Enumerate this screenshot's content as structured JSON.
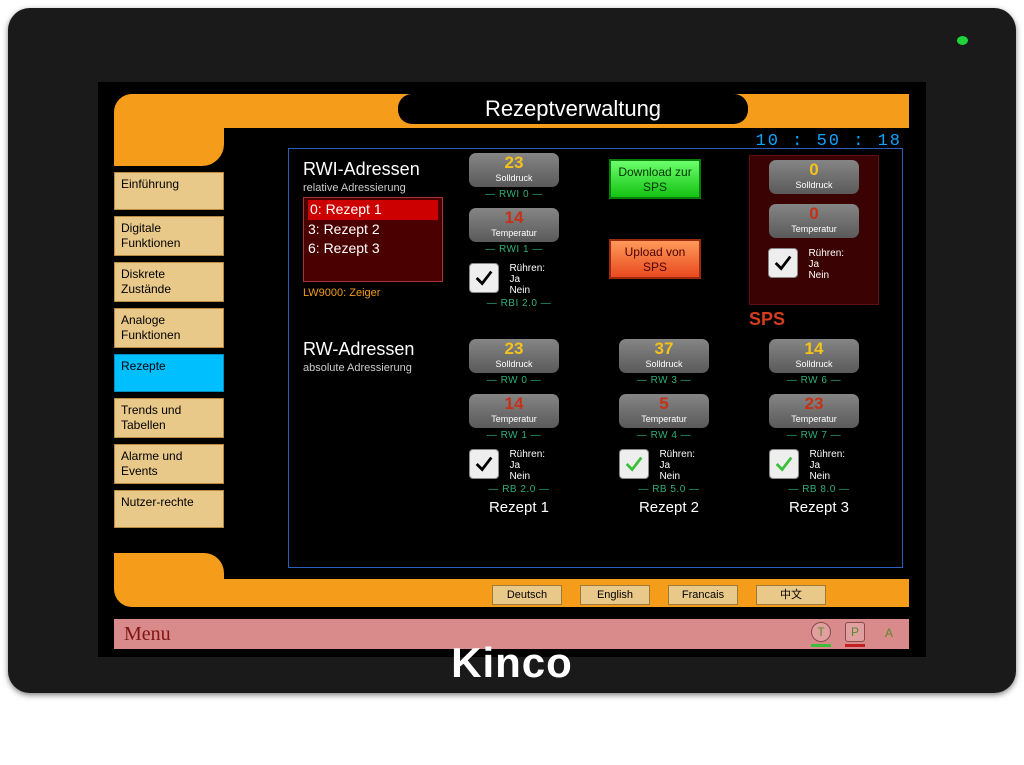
{
  "brand": "Kinco",
  "header": {
    "title": "Rezeptverwaltung",
    "clock": "10 : 50 : 18"
  },
  "sidebar": {
    "items": [
      "Einführung",
      "Digitale Funktionen",
      "Diskrete Zustände",
      "Analoge Funktionen",
      "Rezepte",
      "Trends und Tabellen",
      "Alarme und Events",
      "Nutzer-rechte"
    ],
    "active_index": 4
  },
  "rwi": {
    "title": "RWI-Adressen",
    "subtitle": "relative Adressierung",
    "recipes": [
      "0: Rezept 1",
      "3: Rezept 2",
      "6: Rezept 3"
    ],
    "pointer": "LW9000: Zeiger",
    "solldruck": {
      "value": "23",
      "label": "Solldruck",
      "addr": "— RWI 0 —"
    },
    "temperatur": {
      "value": "14",
      "label": "Temperatur",
      "addr": "— RWI 1 —"
    },
    "ruehren": {
      "label": "Rühren:",
      "ja": "Ja",
      "nein": "Nein",
      "addr": "— RBI 2.0 —",
      "checked": true,
      "check_color": "black"
    }
  },
  "buttons": {
    "download": "Download zur SPS",
    "upload": "Upload von SPS"
  },
  "sps": {
    "label": "SPS",
    "solldruck": {
      "value": "0",
      "label": "Solldruck"
    },
    "temperatur": {
      "value": "0",
      "label": "Temperatur"
    },
    "ruehren": {
      "label": "Rühren:",
      "ja": "Ja",
      "nein": "Nein",
      "checked": true,
      "check_color": "black"
    }
  },
  "rw": {
    "title": "RW-Adressen",
    "subtitle": "absolute Adressierung",
    "cols": [
      {
        "name": "Rezept 1",
        "solldruck": {
          "value": "23",
          "label": "Solldruck",
          "addr": "— RW 0 —"
        },
        "temperatur": {
          "value": "14",
          "label": "Temperatur",
          "addr": "— RW 1 —"
        },
        "ruehren": {
          "addr": "— RB 2.0 —",
          "check_color": "black"
        }
      },
      {
        "name": "Rezept 2",
        "solldruck": {
          "value": "37",
          "label": "Solldruck",
          "addr": "— RW 3 —"
        },
        "temperatur": {
          "value": "5",
          "label": "Temperatur",
          "addr": "— RW 4 —"
        },
        "ruehren": {
          "addr": "— RB 5.0 —",
          "check_color": "green"
        }
      },
      {
        "name": "Rezept 3",
        "solldruck": {
          "value": "14",
          "label": "Solldruck",
          "addr": "— RW 6 —"
        },
        "temperatur": {
          "value": "23",
          "label": "Temperatur",
          "addr": "— RW 7 —"
        },
        "ruehren": {
          "addr": "— RB 8.0 —",
          "check_color": "green"
        }
      }
    ],
    "ruehren_label": {
      "title": "Rühren:",
      "ja": "Ja",
      "nein": "Nein"
    }
  },
  "langs": [
    "Deutsch",
    "English",
    "Francais",
    "中文"
  ],
  "menubar": {
    "label": "Menu",
    "t": "T",
    "p": "P",
    "a": "A"
  }
}
